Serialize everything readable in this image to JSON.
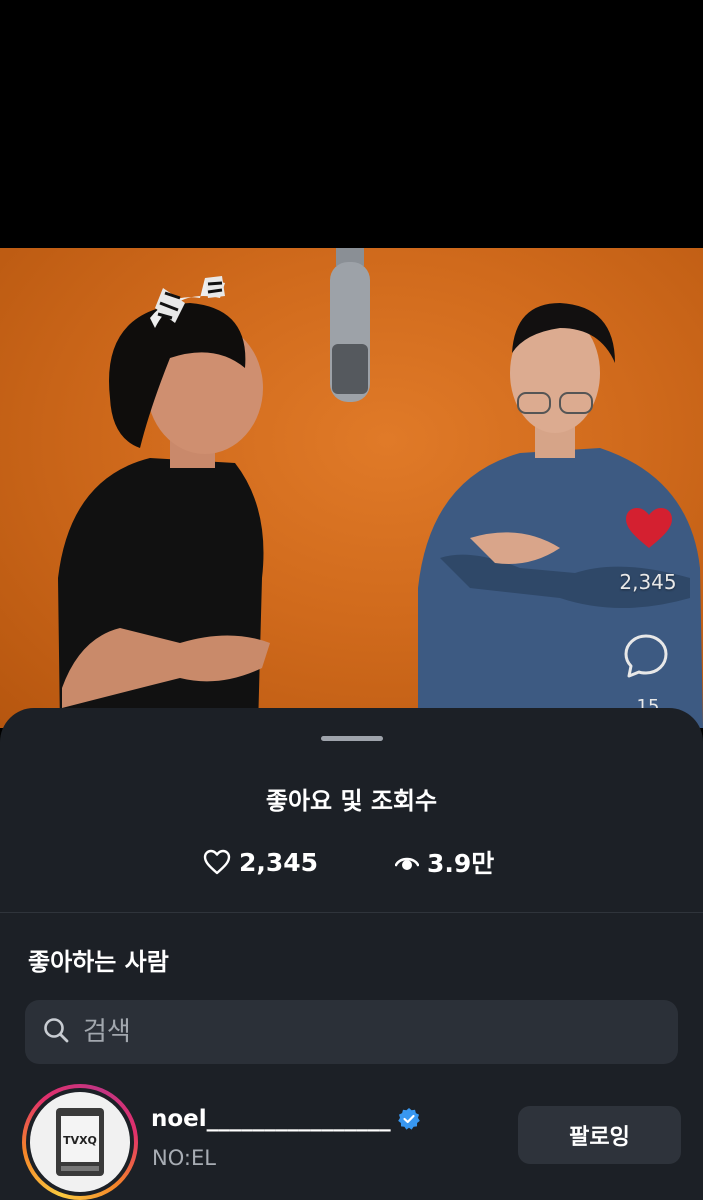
{
  "reel": {
    "like_count": "2,345",
    "comment_count": "15"
  },
  "sheet": {
    "title": "좋아요 및 조회수",
    "stats": {
      "likes": "2,345",
      "views": "3.9만"
    },
    "likers_section_title": "좋아하는 사람",
    "search": {
      "placeholder": "검색"
    },
    "users": [
      {
        "username": "noel________________",
        "full_name": "NO:EL",
        "verified": true,
        "button_label": "팔로잉",
        "avatar_logo_text": "TVXQ"
      }
    ]
  },
  "colors": {
    "sheet_bg": "#1c2026",
    "button_bg": "#2e333b",
    "like_red": "#e0202f",
    "verified_blue": "#3897f0",
    "video_bg": "#d06a1c"
  }
}
